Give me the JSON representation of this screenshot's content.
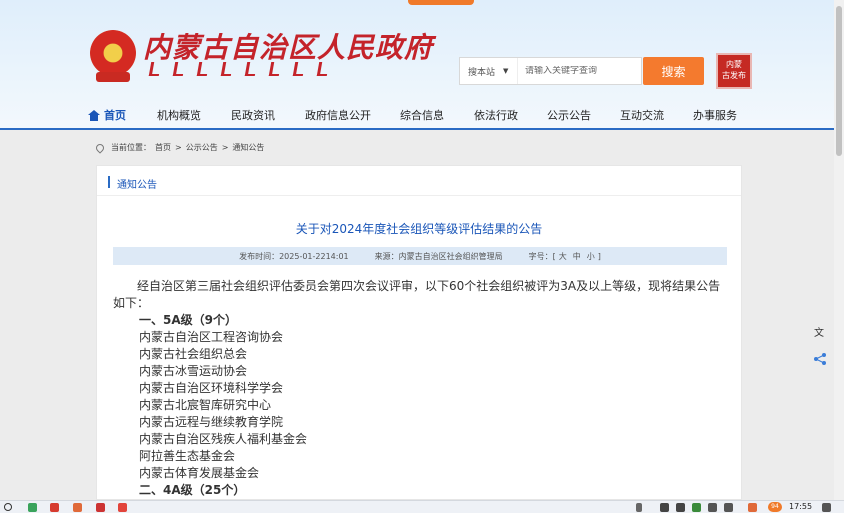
{
  "header": {
    "site_title": "内蒙古自治区人民政府",
    "search": {
      "scope": "搜本站",
      "placeholder": "请输入关键字查询",
      "button": "搜索"
    },
    "stamp_text": "内蒙古发布"
  },
  "nav": {
    "items": [
      {
        "label": "首页",
        "active": true
      },
      {
        "label": "机构概览"
      },
      {
        "label": "民政资讯"
      },
      {
        "label": "政府信息公开"
      },
      {
        "label": "综合信息"
      },
      {
        "label": "依法行政"
      },
      {
        "label": "公示公告"
      },
      {
        "label": "互动交流"
      },
      {
        "label": "办事服务"
      }
    ]
  },
  "breadcrumb": {
    "prefix": "当前位置：",
    "items": [
      "首页",
      ">",
      "公示公告",
      ">",
      "通知公告"
    ]
  },
  "section": {
    "label": "通知公告"
  },
  "article": {
    "title": "关于对2024年度社会组织等级评估结果的公告",
    "published": "发布时间：2025-01-2214:01",
    "source": "来源：内蒙古自治区社会组织管理局",
    "size_label": "字号：[",
    "sizes": [
      "大",
      "中",
      "小"
    ],
    "size_close": "]",
    "intro": "经自治区第三届社会组织评估委员会第四次会议评审，以下60个社会组织被评为3A及以上等级，现将结果公告如下：",
    "heading_5a": "一、5A级（9个）",
    "orgs_5a": [
      "内蒙古自治区工程咨询协会",
      "内蒙古社会组织总会",
      "内蒙古冰雪运动协会",
      "内蒙古自治区环境科学学会",
      "内蒙古北宸智库研究中心",
      "内蒙古远程与继续教育学院",
      "内蒙古自治区残疾人福利基金会",
      "阿拉善生态基金会",
      "内蒙古体育发展基金会"
    ],
    "heading_4a": "二、4A级（25个）"
  },
  "taskbar": {
    "clock": "17:55",
    "badge": "94"
  },
  "colors": {
    "accent": "#1a56b8",
    "search_btn": "#f47a2e",
    "brand_red": "#c4232a"
  }
}
